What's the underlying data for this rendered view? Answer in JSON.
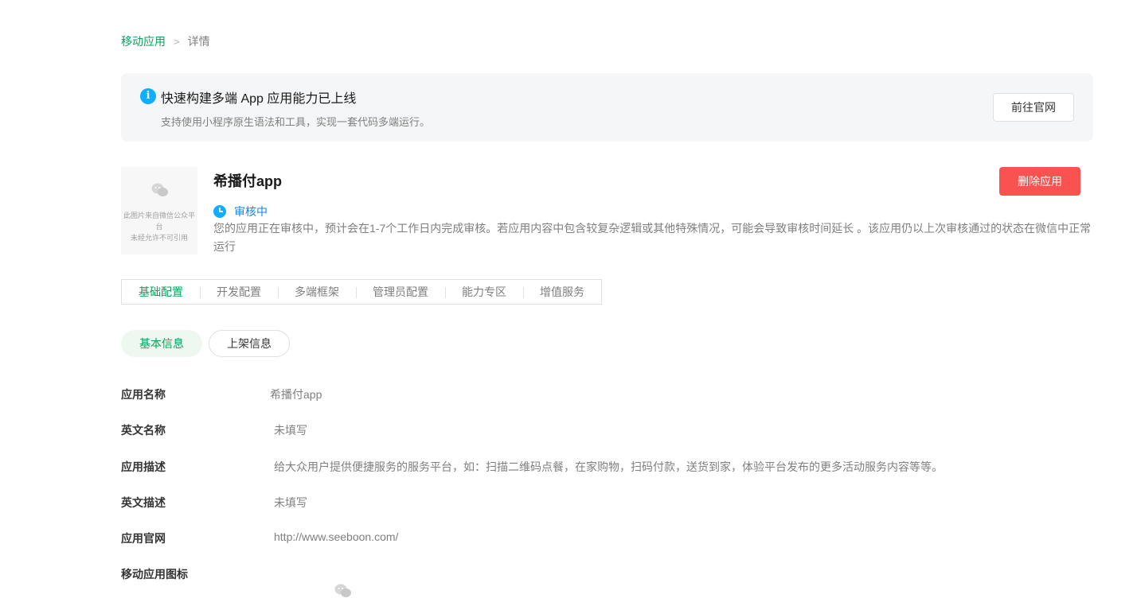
{
  "breadcrumb": {
    "parent": "移动应用",
    "separator": ">",
    "current": "详情"
  },
  "notice": {
    "icon": "info-icon",
    "title": "快速构建多端 App 应用能力已上线",
    "description": "支持使用小程序原生语法和工具，实现一套代码多端运行。",
    "button_label": "前往官网"
  },
  "app": {
    "logo_placeholder_line1": "此图片来自微信公众平台",
    "logo_placeholder_line2": "未经允许不可引用",
    "name": "希播付app",
    "delete_label": "删除应用",
    "status": "审核中",
    "status_description": "您的应用正在审核中，预计会在1-7个工作日内完成审核。若应用内容中包含较复杂逻辑或其他特殊情况，可能会导致审核时间延长 。该应用仍以上次审核通过的状态在微信中正常运行"
  },
  "tabs": [
    {
      "label": "基础配置",
      "active": true
    },
    {
      "label": "开发配置",
      "active": false
    },
    {
      "label": "多端框架",
      "active": false
    },
    {
      "label": "管理员配置",
      "active": false
    },
    {
      "label": "能力专区",
      "active": false
    },
    {
      "label": "增值服务",
      "active": false
    }
  ],
  "subtabs": [
    {
      "label": "基本信息",
      "active": true
    },
    {
      "label": "上架信息",
      "active": false
    }
  ],
  "info": [
    {
      "label": "应用名称",
      "value": "希播付app"
    },
    {
      "label": "英文名称",
      "value": "未填写"
    },
    {
      "label": "应用描述",
      "value": "给大众用户提供便捷服务的服务平台，如：扫描二维码点餐，在家购物，扫码付款，送货到家，体验平台发布的更多活动服务内容等等。"
    },
    {
      "label": "英文描述",
      "value": "未填写"
    },
    {
      "label": "应用官网",
      "value": "http://www.seeboon.com/"
    },
    {
      "label": "移动应用图标",
      "value": ""
    }
  ],
  "colors": {
    "brand_green": "#07a35a",
    "danger_red": "#fa5151",
    "status_blue": "#1485ee",
    "info_blue": "#10aeff"
  }
}
